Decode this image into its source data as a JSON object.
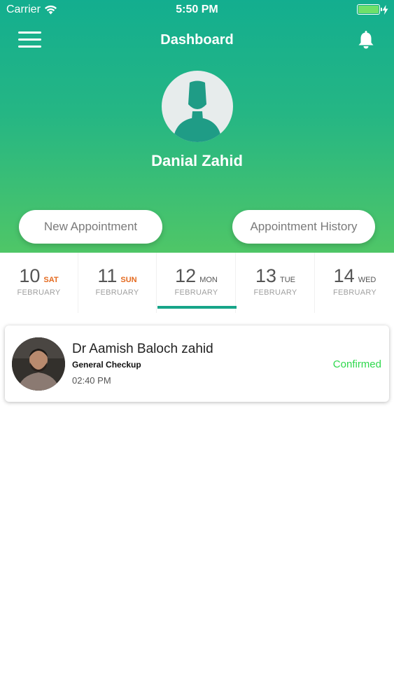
{
  "status_bar": {
    "carrier": "Carrier",
    "time": "5:50 PM",
    "wifi_icon": "wifi-icon",
    "battery_icon": "battery-icon",
    "charging_icon": "charging-bolt-icon"
  },
  "header": {
    "menu_icon": "hamburger-menu-icon",
    "title": "Dashboard",
    "bell_icon": "bell-icon"
  },
  "profile": {
    "avatar_icon": "user-placeholder-avatar",
    "name": "Danial Zahid"
  },
  "actions": {
    "new_appointment": "New Appointment",
    "appointment_history": "Appointment History"
  },
  "dates": [
    {
      "day": "10",
      "weekday": "SAT",
      "month": "FEBRUARY",
      "weekend": true,
      "selected": false
    },
    {
      "day": "11",
      "weekday": "SUN",
      "month": "FEBRUARY",
      "weekend": true,
      "selected": false
    },
    {
      "day": "12",
      "weekday": "MON",
      "month": "FEBRUARY",
      "weekend": false,
      "selected": true
    },
    {
      "day": "13",
      "weekday": "TUE",
      "month": "FEBRUARY",
      "weekend": false,
      "selected": false
    },
    {
      "day": "14",
      "weekday": "WED",
      "month": "FEBRUARY",
      "weekend": false,
      "selected": false
    }
  ],
  "appointment": {
    "doctor_name": "Dr Aamish Baloch zahid",
    "type": "General Checkup",
    "time": "02:40 PM",
    "status": "Confirmed"
  },
  "colors": {
    "gradient_top": "#13ae8f",
    "gradient_bottom": "#4fc667",
    "accent": "#17a589",
    "weekend": "#e46a1f",
    "confirmed": "#2ed84c"
  }
}
